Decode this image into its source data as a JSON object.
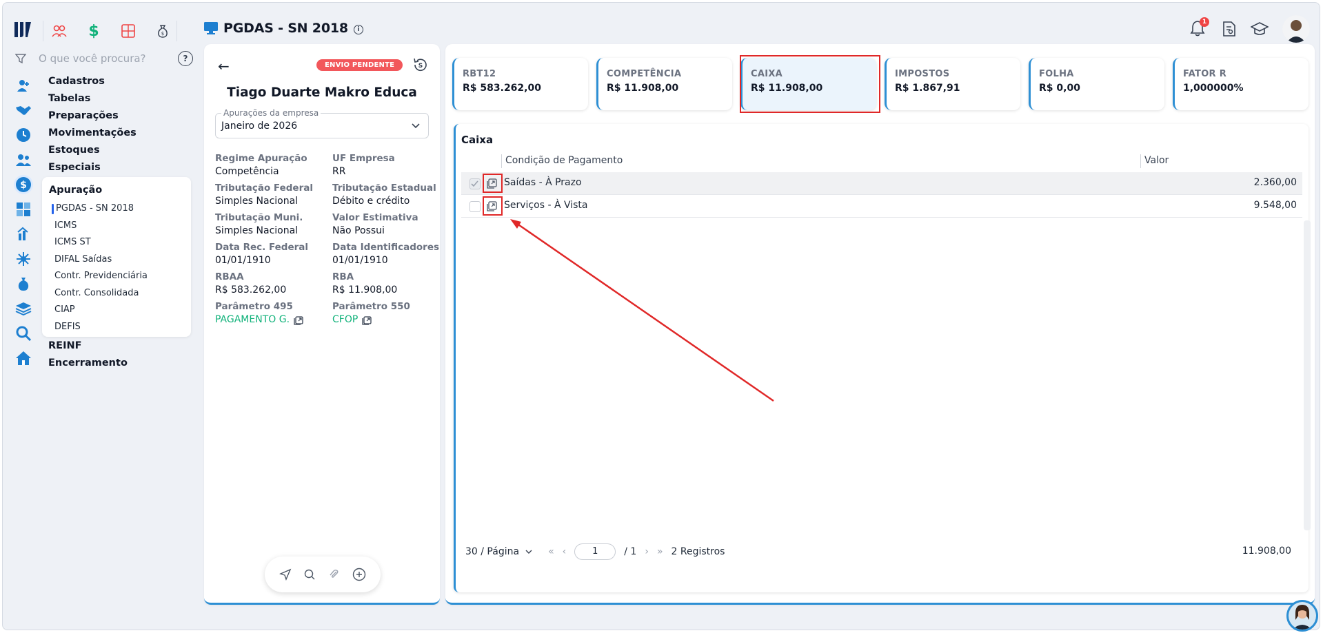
{
  "header": {
    "title": "PGDAS - SN 2018",
    "notification_count": "1",
    "top_icons": [
      "users-icon",
      "dollar-icon",
      "calculator-icon",
      "money-bag-icon"
    ]
  },
  "sidebar": {
    "search_placeholder": "O que você procura?",
    "items": [
      {
        "label": "Cadastros",
        "icon": "user-plus-icon"
      },
      {
        "label": "Tabelas",
        "icon": "handshake-icon"
      },
      {
        "label": "Preparações",
        "icon": "clock-icon"
      },
      {
        "label": "Movimentações",
        "icon": "users-icon"
      },
      {
        "label": "Estoques",
        "icon": "dollar-circle-icon"
      },
      {
        "label": "Especiais",
        "icon": "grid-icon"
      }
    ],
    "submenu": {
      "title": "Apuração",
      "items": [
        "PGDAS - SN 2018",
        "ICMS",
        "ICMS ST",
        "DIFAL Saídas",
        "Contr. Previdenciária",
        "Contr. Consolidada",
        "CIAP",
        "DEFIS"
      ]
    },
    "after_items": [
      "REINF",
      "Encerramento"
    ]
  },
  "left_panel": {
    "status": "ENVIO PENDENTE",
    "company": "Tiago Duarte Makro Educa",
    "select_label": "Apurações da empresa",
    "select_value": "Janeiro de 2026",
    "fields": [
      {
        "label": "Regime Apuração",
        "value": "Competência"
      },
      {
        "label": "UF Empresa",
        "value": "RR"
      },
      {
        "label": "Tributação Federal",
        "value": "Simples Nacional"
      },
      {
        "label": "Tributação Estadual",
        "value": "Débito e crédito"
      },
      {
        "label": "Tributação Muni.",
        "value": "Simples Nacional"
      },
      {
        "label": "Valor Estimativa",
        "value": "Não Possui"
      },
      {
        "label": "Data Rec. Federal",
        "value": "01/01/1910"
      },
      {
        "label": "Data Identificadores",
        "value": "01/01/1910"
      },
      {
        "label": "RBAA",
        "value": "R$ 583.262,00"
      },
      {
        "label": "RBA",
        "value": "R$ 11.908,00"
      },
      {
        "label": "Parâmetro 495",
        "value": "PAGAMENTO G."
      },
      {
        "label": "Parâmetro 550",
        "value": "CFOP"
      }
    ]
  },
  "kpis": [
    {
      "label": "RBT12",
      "value": "R$ 583.262,00"
    },
    {
      "label": "COMPETÊNCIA",
      "value": "R$ 11.908,00"
    },
    {
      "label": "CAIXA",
      "value": "R$ 11.908,00"
    },
    {
      "label": "IMPOSTOS",
      "value": "R$ 1.867,91"
    },
    {
      "label": "FOLHA",
      "value": "R$ 0,00"
    },
    {
      "label": "FATOR R",
      "value": "1,000000%"
    }
  ],
  "table": {
    "title": "Caixa",
    "columns": [
      "Condição de Pagamento",
      "Valor"
    ],
    "rows": [
      {
        "condition": "Saídas - À Prazo",
        "value": "2.360,00",
        "checked": true
      },
      {
        "condition": "Serviços - À Vista",
        "value": "9.548,00",
        "checked": false
      }
    ],
    "page_size": "30 / Página",
    "current_page": "1",
    "total_pages": "/ 1",
    "records": "2 Registros",
    "total": "11.908,00"
  },
  "colors": {
    "accent": "#2d8fd4",
    "badge": "#f2575b",
    "link": "#10b27a",
    "highlight": "#e02828"
  }
}
